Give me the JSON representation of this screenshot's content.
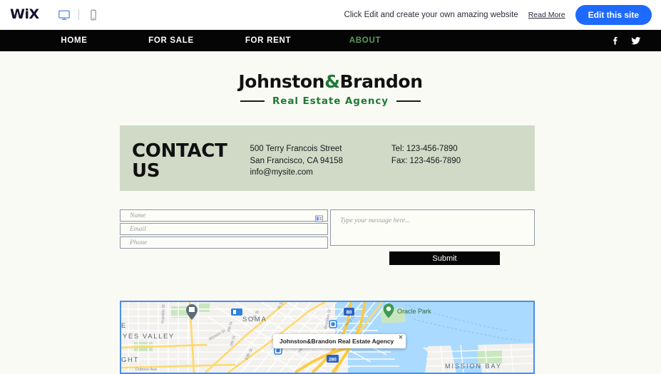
{
  "wix_bar": {
    "logo": "WiX",
    "desktop_icon": "desktop-monitor-icon",
    "mobile_icon": "mobile-phone-icon",
    "message": "Click Edit and create your own amazing website",
    "read_more": "Read More",
    "edit_button": "Edit this site",
    "accent_blue": "#1E6AFF"
  },
  "site_nav": {
    "items": [
      {
        "label": "HOME",
        "active": false
      },
      {
        "label": "FOR SALE",
        "active": false
      },
      {
        "label": "FOR RENT",
        "active": false
      },
      {
        "label": "ABOUT",
        "active": true
      }
    ],
    "active_color": "#5c9c5c",
    "background": "#050505",
    "social": [
      {
        "name": "facebook-icon"
      },
      {
        "name": "twitter-icon"
      }
    ]
  },
  "brand": {
    "name_part1": "Johnston",
    "ampersand": "&",
    "name_part2": "Brandon",
    "tagline": "Real Estate Agency",
    "green": "#1f7a37"
  },
  "contact": {
    "heading_line1": "CONTACT",
    "heading_line2": "US",
    "address_line1": "500 Terry Francois Street",
    "address_line2": "San Francisco, CA  94158",
    "email": "info@mysite.com",
    "tel": "Tel: 123-456-7890",
    "fax": "Fax: 123-456-7890",
    "panel_color": "#D0DAC7"
  },
  "form": {
    "name_placeholder": "Name",
    "email_placeholder": "Email",
    "phone_placeholder": "Phone",
    "message_placeholder": "Type your message here...",
    "submit_label": "Submit",
    "autofill_icon": "contact-card-icon"
  },
  "map": {
    "info_window_title": "Johnston&Brandon Real Estate Agency",
    "close_icon": "close-icon",
    "marker_icon": "location-pin-icon",
    "labels": {
      "soma": "SOMA",
      "oracle_park": "Oracle Park",
      "hayes_valley": "YES VALLEY",
      "mission_bay": "MISSION BAY",
      "haight": "GHT",
      "edge_e": "E",
      "streets": [
        "Franklin St",
        "7th St",
        "8th St",
        "9th St",
        "10th St",
        "Mission St",
        "Brandon St",
        "King St",
        "7th St",
        "Duboce Ave"
      ],
      "highways": [
        "80",
        "280"
      ]
    },
    "water_color": "#AADAFF",
    "land_color": "#F2F1EE",
    "road_color": "#FFD96B",
    "park_color": "#C9E6C0"
  },
  "page": {
    "background": "#FAFAF5"
  }
}
